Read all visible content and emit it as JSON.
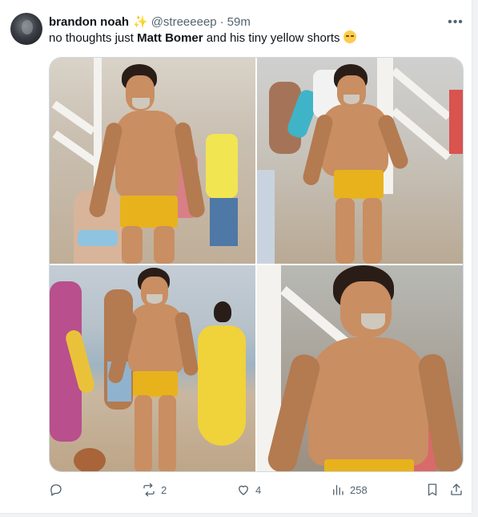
{
  "author": {
    "display_name": "brandon noah",
    "badge": "✨",
    "handle": "@streeeeep",
    "separator": "·",
    "time": "59m"
  },
  "menu_icon": "more-horizontal-icon",
  "tweet_text": {
    "before": "no thoughts just ",
    "bold": "Matt Bomer",
    "after": " and his tiny yellow shorts "
  },
  "media": {
    "count": 4
  },
  "actions": {
    "reply": {
      "icon": "reply-icon",
      "count": ""
    },
    "retweet": {
      "icon": "retweet-icon",
      "count": "2"
    },
    "like": {
      "icon": "heart-icon",
      "count": "4"
    },
    "views": {
      "icon": "views-chart-icon",
      "count": "258"
    },
    "bookmark": {
      "icon": "bookmark-icon"
    },
    "share": {
      "icon": "share-icon"
    }
  },
  "colors": {
    "text": "#0f1419",
    "secondary": "#536471",
    "border": "#cfd9de",
    "shorts": "#e8b21c"
  }
}
